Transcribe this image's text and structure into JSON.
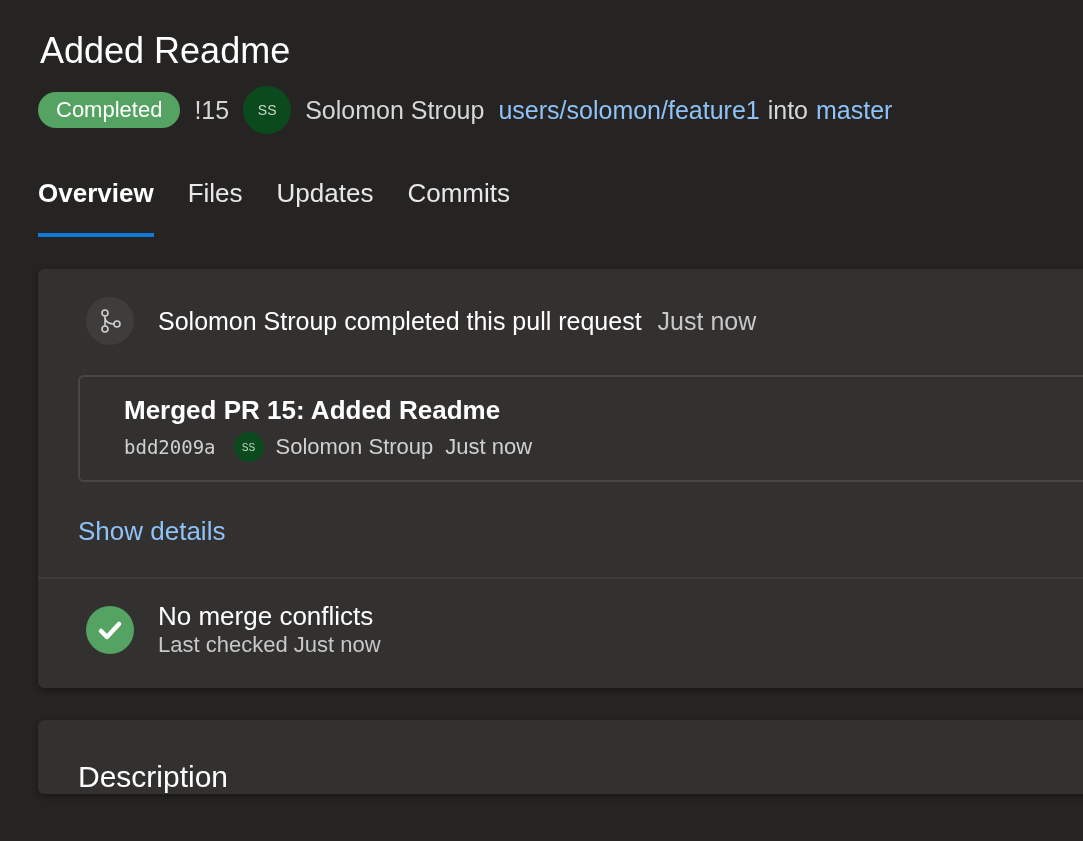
{
  "title": "Added Readme",
  "header": {
    "status": "Completed",
    "pr_number": "!15",
    "author_initials": "SS",
    "author": "Solomon Stroup",
    "source_branch": "users/solomon/feature1",
    "into": "into",
    "target_branch": "master"
  },
  "tabs": [
    {
      "label": "Overview",
      "selected": true
    },
    {
      "label": "Files",
      "selected": false
    },
    {
      "label": "Updates",
      "selected": false
    },
    {
      "label": "Commits",
      "selected": false
    }
  ],
  "activity": {
    "message": "Solomon Stroup completed this pull request",
    "time": "Just now",
    "commit": {
      "title": "Merged PR 15: Added Readme",
      "hash": "bdd2009a",
      "author_initials": "SS",
      "author": "Solomon Stroup",
      "time": "Just now"
    },
    "show_details": "Show details"
  },
  "merge_status": {
    "title": "No merge conflicts",
    "subtitle": "Last checked Just now"
  },
  "description": {
    "heading": "Description"
  }
}
